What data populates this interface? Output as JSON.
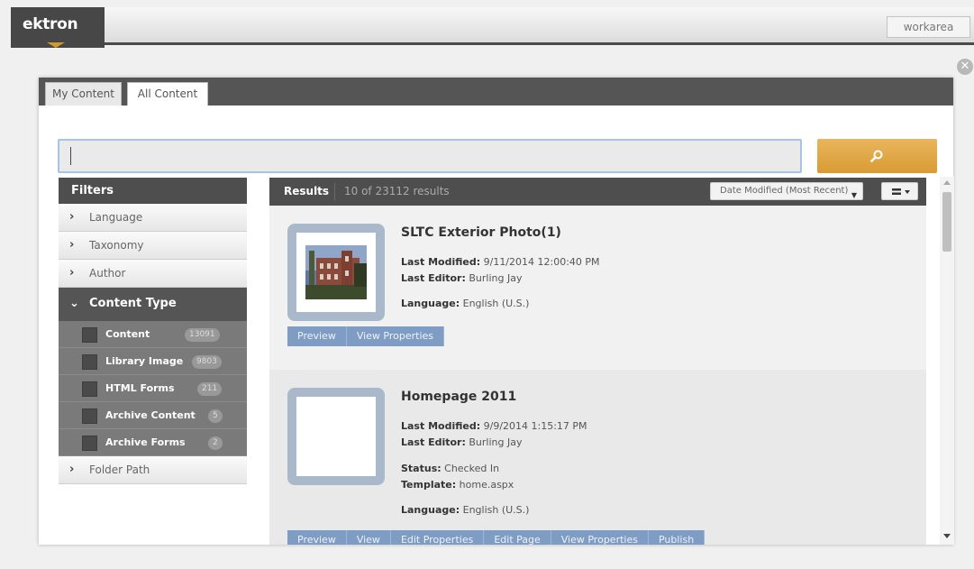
{
  "header": {
    "logo": "ektron",
    "workarea_label": "workarea",
    "accent_color": "#d19a2a"
  },
  "tabs": [
    {
      "label": "My Content",
      "active": false
    },
    {
      "label": "All Content",
      "active": true
    }
  ],
  "search": {
    "value": "",
    "button_icon": "search-icon",
    "button_color": "#e0a543"
  },
  "filters": {
    "title": "Filters",
    "items": [
      {
        "label": "Language",
        "icon": "chevron-right-icon"
      },
      {
        "label": "Taxonomy",
        "icon": "chevron-right-icon"
      },
      {
        "label": "Author",
        "icon": "chevron-right-icon"
      }
    ],
    "content_type": {
      "label": "Content Type",
      "icon": "chevron-down-icon",
      "options": [
        {
          "label": "Content",
          "count": "13091"
        },
        {
          "label": "Library Image",
          "count": "9803"
        },
        {
          "label": "HTML Forms",
          "count": "211"
        },
        {
          "label": "Archive Content",
          "count": "5"
        },
        {
          "label": "Archive Forms",
          "count": "2"
        }
      ]
    },
    "folder_path": {
      "label": "Folder Path",
      "icon": "chevron-right-icon"
    }
  },
  "results": {
    "title": "Results",
    "count_text": "10 of 23112 results",
    "sort_label": "Date Modified (Most Recent)",
    "items": [
      {
        "title": "SLTC Exterior Photo(1)",
        "last_modified_label": "Last Modified:",
        "last_modified": "9/11/2014 12:00:40 PM",
        "last_editor_label": "Last Editor:",
        "last_editor": "Burling Jay",
        "language_label": "Language:",
        "language": "English (U.S.)",
        "actions": [
          "Preview",
          "View Properties"
        ]
      },
      {
        "title": "Homepage 2011",
        "last_modified_label": "Last Modified:",
        "last_modified": "9/9/2014 1:15:17 PM",
        "last_editor_label": "Last Editor:",
        "last_editor": "Burling Jay",
        "status_label": "Status:",
        "status": "Checked In",
        "template_label": "Template:",
        "template": "home.aspx",
        "language_label": "Language:",
        "language": "English (U.S.)",
        "actions": [
          "Preview",
          "View",
          "Edit Properties",
          "Edit Page",
          "View Properties",
          "Publish"
        ]
      }
    ]
  }
}
